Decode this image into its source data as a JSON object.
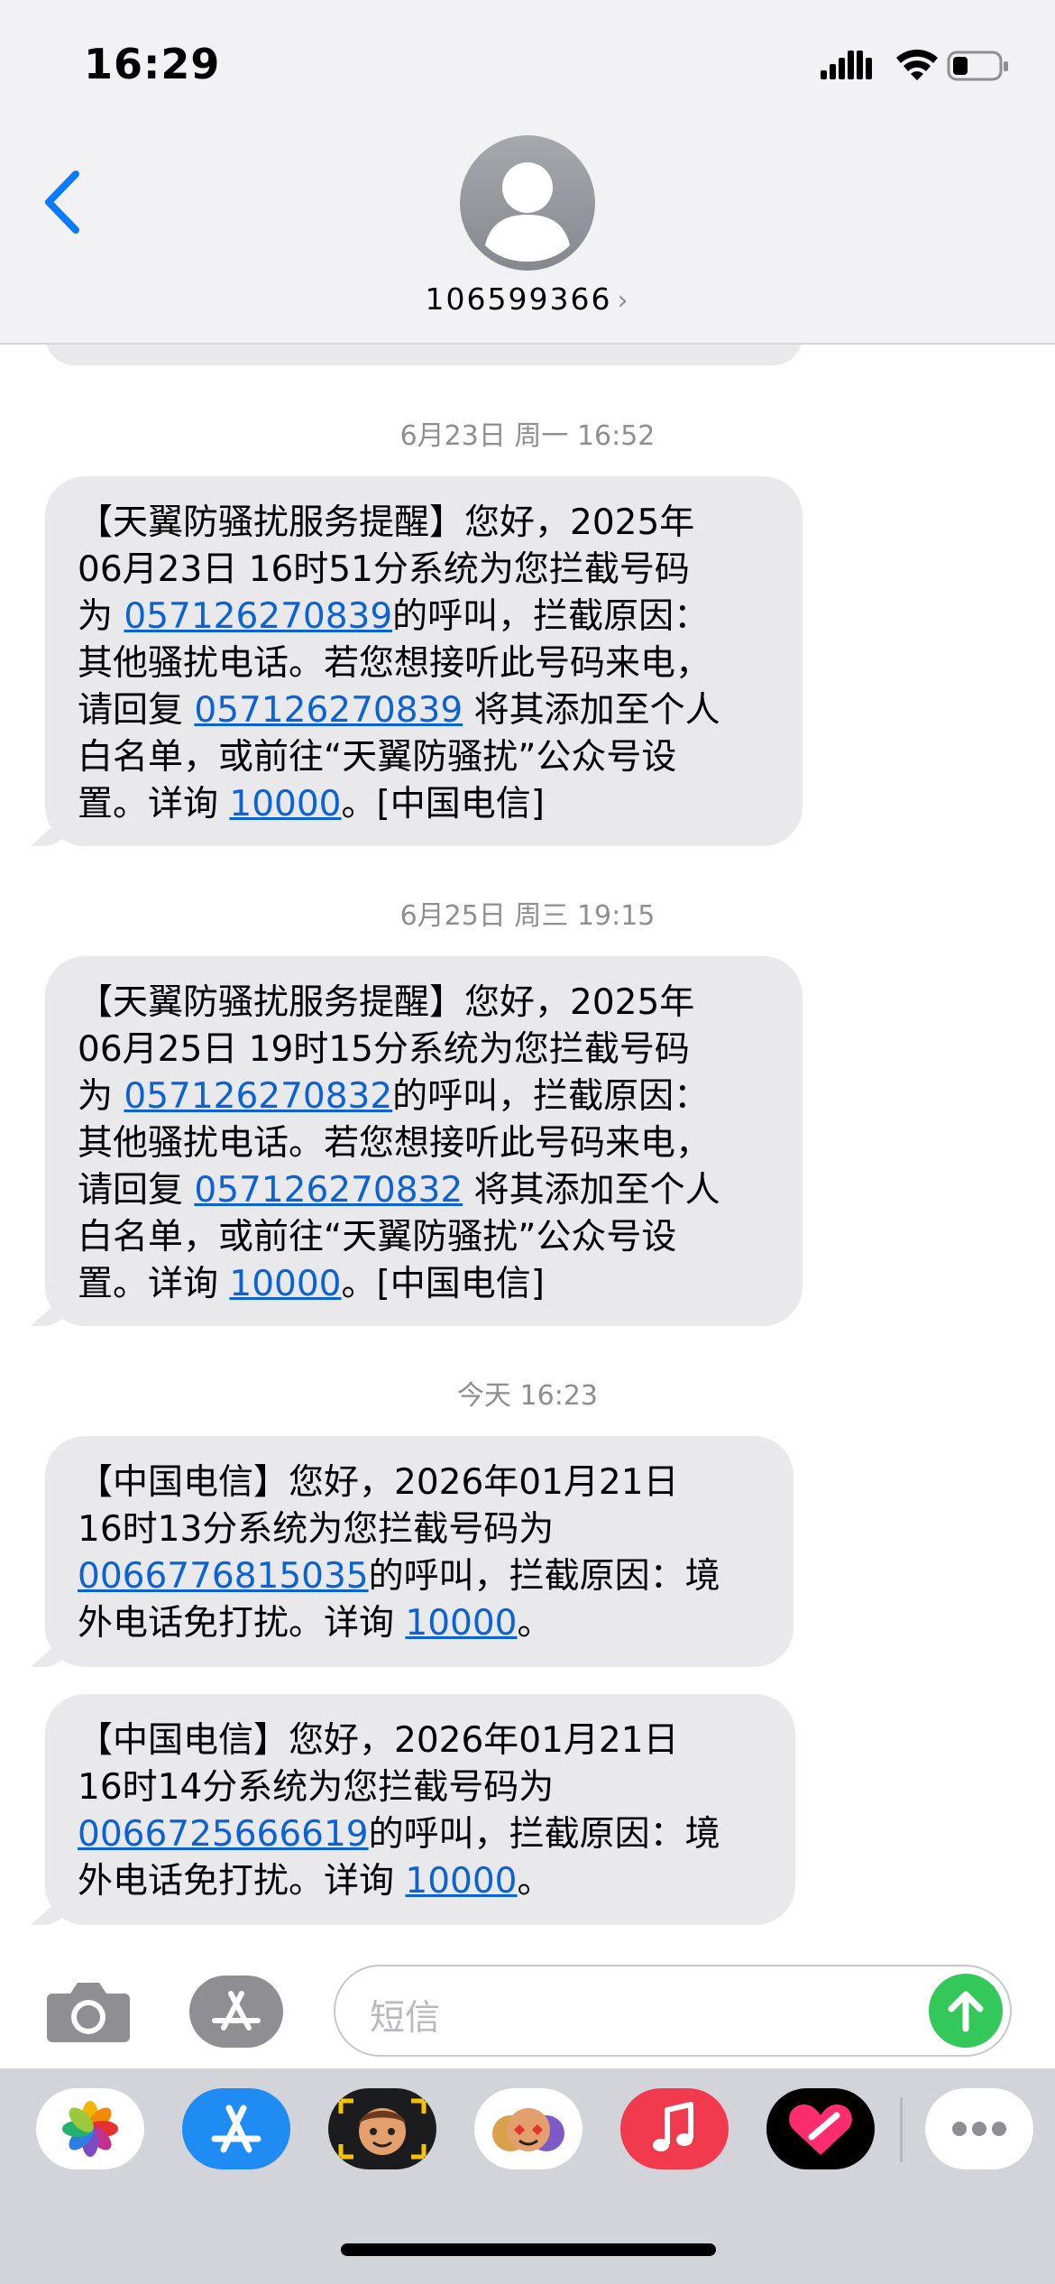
{
  "status_bar": {
    "time": "16:29"
  },
  "header": {
    "contact": "106599366",
    "chevron": "›"
  },
  "thread": [
    {
      "timestamp": {
        "date": "6月23日 周一",
        "time": "16:52"
      },
      "lines": [
        [
          {
            "t": "【天翼防骚扰服务提醒】您好，2025年"
          }
        ],
        [
          {
            "t": "06月23日 16时51分系统为您拦截号码"
          }
        ],
        [
          {
            "t": "为 "
          },
          {
            "t": "057126270839",
            "link": true
          },
          {
            "t": "的呼叫，拦截原因："
          }
        ],
        [
          {
            "t": "其他骚扰电话。若您想接听此号码来电，"
          }
        ],
        [
          {
            "t": "请回复 "
          },
          {
            "t": "057126270839",
            "link": true
          },
          {
            "t": " 将其添加至个人"
          }
        ],
        [
          {
            "t": "白名单，或前往“天翼防骚扰”公众号设"
          }
        ],
        [
          {
            "t": "置。详询 "
          },
          {
            "t": "10000",
            "link": true
          },
          {
            "t": "。[中国电信]"
          }
        ]
      ]
    },
    {
      "timestamp": {
        "date": "6月25日 周三",
        "time": "19:15"
      },
      "lines": [
        [
          {
            "t": "【天翼防骚扰服务提醒】您好，2025年"
          }
        ],
        [
          {
            "t": "06月25日 19时15分系统为您拦截号码"
          }
        ],
        [
          {
            "t": "为 "
          },
          {
            "t": "057126270832",
            "link": true
          },
          {
            "t": "的呼叫，拦截原因："
          }
        ],
        [
          {
            "t": "其他骚扰电话。若您想接听此号码来电，"
          }
        ],
        [
          {
            "t": "请回复 "
          },
          {
            "t": "057126270832",
            "link": true
          },
          {
            "t": " 将其添加至个人"
          }
        ],
        [
          {
            "t": "白名单，或前往“天翼防骚扰”公众号设"
          }
        ],
        [
          {
            "t": "置。详询 "
          },
          {
            "t": "10000",
            "link": true
          },
          {
            "t": "。[中国电信]"
          }
        ]
      ]
    },
    {
      "timestamp": {
        "date": "今天",
        "time": "16:23"
      },
      "lines": [
        [
          {
            "t": "【中国电信】您好，2026年01月21日"
          }
        ],
        [
          {
            "t": "16时13分系统为您拦截号码为"
          }
        ],
        [
          {
            "t": "0066776815035",
            "link": true
          },
          {
            "t": "的呼叫，拦截原因：境"
          }
        ],
        [
          {
            "t": "外电话免打扰。详询 "
          },
          {
            "t": "10000",
            "link": true
          },
          {
            "t": "。"
          }
        ]
      ]
    },
    {
      "timestamp": null,
      "lines": [
        [
          {
            "t": "【中国电信】您好，2026年01月21日"
          }
        ],
        [
          {
            "t": "16时14分系统为您拦截号码为"
          }
        ],
        [
          {
            "t": "0066725666619",
            "link": true
          },
          {
            "t": "的呼叫，拦截原因：境"
          }
        ],
        [
          {
            "t": "外电话免打扰。详询 "
          },
          {
            "t": "10000",
            "link": true
          },
          {
            "t": "。"
          }
        ]
      ]
    }
  ],
  "input": {
    "placeholder": "短信"
  },
  "drawer": {
    "apps": [
      "photos-icon",
      "app-store-icon",
      "memoji-icon",
      "animoji-icon",
      "music-icon",
      "digital-touch-icon",
      "more-icon"
    ]
  },
  "colors": {
    "bubble": "#e9e9eb",
    "link": "#0b62d6",
    "send": "#34c759",
    "back": "#0a7aff"
  }
}
